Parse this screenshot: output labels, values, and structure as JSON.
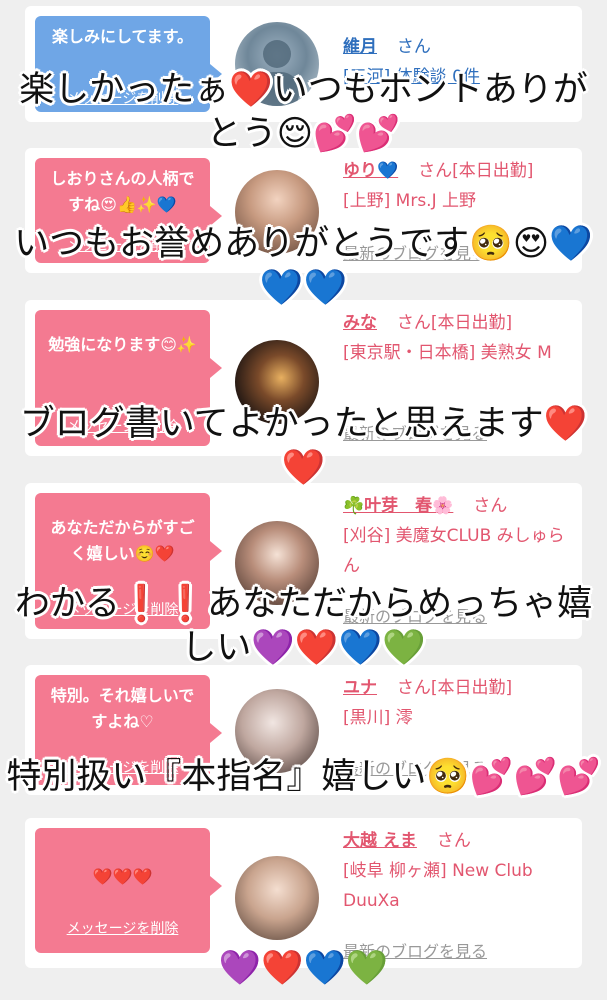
{
  "cards": [
    {
      "bubble_text": "楽しみにしてます。",
      "delete_label": "メッセージを削除",
      "name": "維月",
      "suffix": "さん",
      "shop": "[三河] 体験談 0件",
      "blog_label": ""
    },
    {
      "bubble_text": "しおりさんの人柄ですね😍👍✨💙",
      "delete_label": "メッセージを削除",
      "name": "ゆり💙",
      "suffix": "さん[本日出勤]",
      "shop": "[上野] Mrs.J 上野",
      "blog_label": "最新のブログを見る"
    },
    {
      "bubble_text": "勉強になります😊✨",
      "delete_label": "メッセージを削除",
      "name": "みな",
      "suffix": "さん[本日出勤]",
      "shop": "[東京駅・日本橋] 美熟女 M",
      "blog_label": "最新のブログを見る"
    },
    {
      "bubble_text": "あなただからがすごく嬉しい☺️❤️",
      "delete_label": "メッセージを削除",
      "name": "☘️叶芽　春🌸",
      "suffix": "さん",
      "shop": "[刈谷] 美魔女CLUB みしゅらん",
      "blog_label": "最新のブログを見る"
    },
    {
      "bubble_text": "特別。それ嬉しいですよね♡",
      "delete_label": "メッセージを削除",
      "name": "ユナ",
      "suffix": "さん[本日出勤]",
      "shop": "[黒川] 澪",
      "blog_label": "最新のブログを見る"
    },
    {
      "bubble_text": "❤️❤️❤️",
      "delete_label": "メッセージを削除",
      "name": "大越 えま",
      "suffix": "さん",
      "shop": "[岐阜 柳ヶ瀬] New Club DuuXa",
      "blog_label": "最新のブログを見る"
    }
  ],
  "overlays": [
    {
      "text": "楽しかったぁ❤️いつもホントありがとう😌💕💕"
    },
    {
      "text": "いつもお誉めありがとうです🥺😍💙💙💙"
    },
    {
      "text": "ブログ書いてよかったと思えます❤️❤️"
    },
    {
      "text": "わかる❗️❗️あなただからめっちゃ嬉しい💜❤️💙💚"
    },
    {
      "text": "特別扱い『本指名』嬉しい🥺💕💕💕"
    }
  ],
  "bottom_hearts": "💜❤️💙💚",
  "colors": {
    "pink": "#f47a91",
    "blue": "#6fa6e6",
    "name": "#e2566f",
    "background": "#efefef"
  }
}
